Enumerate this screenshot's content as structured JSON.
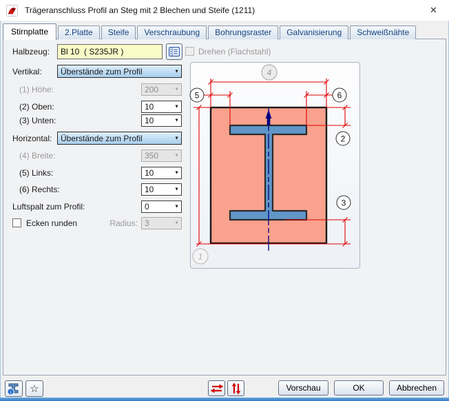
{
  "window": {
    "title": "Trägeranschluss Profil an Steg mit 2 Blechen und Steife (1211)",
    "close_glyph": "✕"
  },
  "tabs": {
    "items": [
      {
        "label": "Stirnplatte",
        "active": true
      },
      {
        "label": "2.Platte",
        "active": false
      },
      {
        "label": "Steife",
        "active": false
      },
      {
        "label": "Verschraubung",
        "active": false
      },
      {
        "label": "Bohrungsraster",
        "active": false
      },
      {
        "label": "Galvanisierung",
        "active": false
      },
      {
        "label": "Schweißnähte",
        "active": false
      }
    ]
  },
  "form": {
    "halbzeug": {
      "label": "Halbzeug:",
      "value": "Bl 10  ( S235JR )"
    },
    "drehen": {
      "label": "Drehen (Flachstahl)",
      "checked": false,
      "disabled": true
    },
    "vertikal": {
      "label": "Vertikal:",
      "value": "Überstände zum Profil"
    },
    "hoehe": {
      "label": "(1) Höhe:",
      "value": "200",
      "disabled": true
    },
    "oben": {
      "label": "(2) Oben:",
      "value": "10"
    },
    "unten": {
      "label": "(3) Unten:",
      "value": "10"
    },
    "horizontal": {
      "label": "Horizontal:",
      "value": "Überstände zum Profil"
    },
    "breite": {
      "label": "(4) Breite:",
      "value": "350",
      "disabled": true
    },
    "links": {
      "label": "(5) Links:",
      "value": "10"
    },
    "rechts": {
      "label": "(6) Rechts:",
      "value": "10"
    },
    "luftspalt": {
      "label": "Luftspalt zum Profil:",
      "value": "0"
    },
    "ecken": {
      "label": "Ecken runden",
      "checked": false
    },
    "radius": {
      "label": "Radius:",
      "value": "3",
      "disabled": true
    }
  },
  "diagram": {
    "markers": {
      "m1": "1",
      "m2": "2",
      "m3": "3",
      "m4": "4",
      "m5": "5",
      "m6": "6"
    }
  },
  "footer": {
    "vorschau": "Vorschau",
    "ok": "OK",
    "abbrechen": "Abbrechen",
    "star_glyph": "☆"
  },
  "colors": {
    "plate": "#f9a28d",
    "beam": "#6096c8",
    "dimension_red": "#e00000",
    "centerline_navy": "#000080",
    "field_yellow": "#fbfbc8",
    "tab_text_blue": "#16437e",
    "accent_bar_blue": "#3a78c0"
  }
}
